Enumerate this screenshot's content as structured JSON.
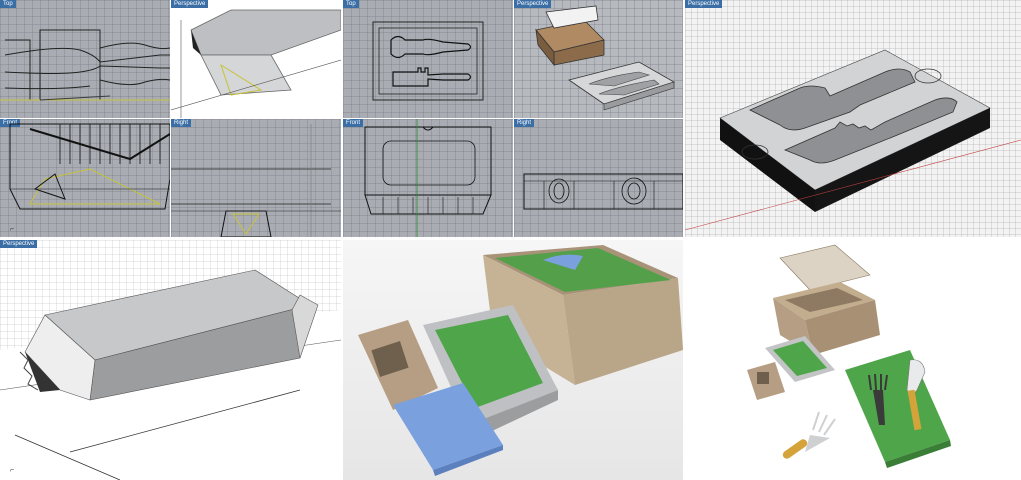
{
  "panels": {
    "p1": {
      "vp1": "Top",
      "vp2": "Perspective",
      "vp3": "Front",
      "vp4": "Right"
    },
    "p2": {
      "vp1": "Top",
      "vp2": "Perspective",
      "vp3": "Front",
      "vp4": "Right"
    },
    "p3": {
      "vp1": "Perspective"
    },
    "p4": {
      "vp1": "Perspective"
    }
  },
  "colors": {
    "viewport_bg": "#a9adb3",
    "label_bg": "#3a6ea5",
    "cardboard": "#b59e83",
    "foil": "#c8c9cb",
    "green_fill": "#4fa64a",
    "blue_sponge": "#7aa0de",
    "handle_wood": "#d4a43a"
  },
  "icons": [
    "axis-gizmo-icon"
  ]
}
